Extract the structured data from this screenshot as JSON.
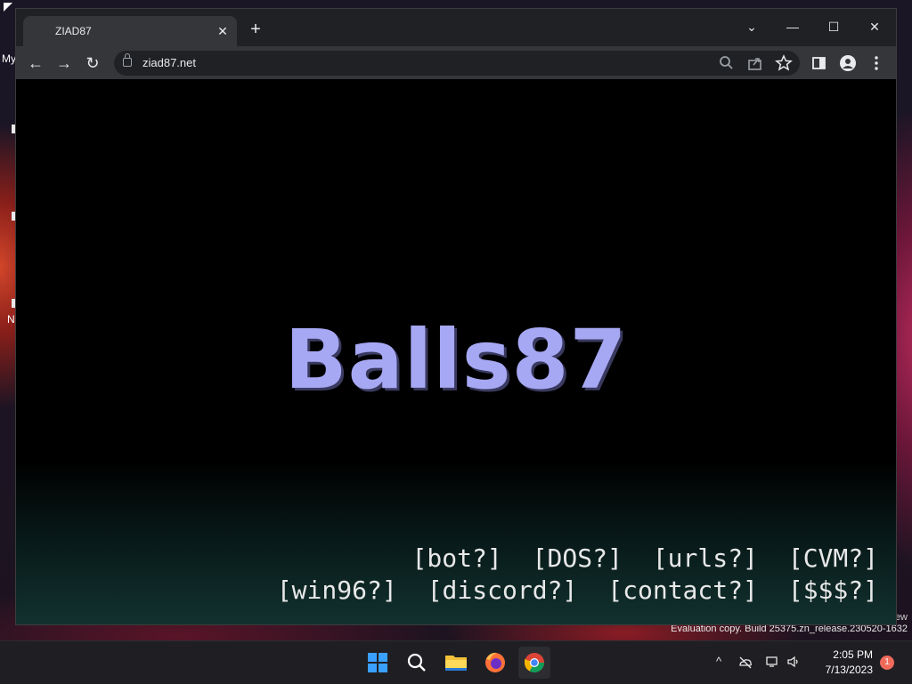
{
  "desktop": {
    "icon_labels": [
      "My",
      "N"
    ],
    "watermark_clip": "ew",
    "watermark": "Evaluation copy. Build 25375.zn_release.230520-1632"
  },
  "browser": {
    "tab_title": "ZIAD87",
    "tab_close_glyph": "✕",
    "new_tab_glyph": "+",
    "url": "ziad87.net",
    "controls": {
      "dropdown": "⌄",
      "minimize": "—",
      "maximize": "☐",
      "close": "✕"
    },
    "nav": {
      "back": "←",
      "forward": "→",
      "reload": "↻"
    },
    "icons": [
      "search-icon",
      "share-icon",
      "bookmark-star-icon",
      "side-panel-icon",
      "profile-icon",
      "menu-icon"
    ]
  },
  "page": {
    "title": "Balls87",
    "links_row1": [
      "[bot?]",
      "[DOS?]",
      "[urls?]",
      "[CVM?]"
    ],
    "links_row2": [
      "[win96?]",
      "[discord?]",
      "[contact?]",
      "[$$$?]"
    ]
  },
  "taskbar": {
    "apps": [
      "start-icon",
      "search-icon",
      "file-explorer-icon",
      "firefox-icon",
      "chrome-icon"
    ],
    "time": "2:05 PM",
    "date": "7/13/2023",
    "notifications": "1"
  }
}
